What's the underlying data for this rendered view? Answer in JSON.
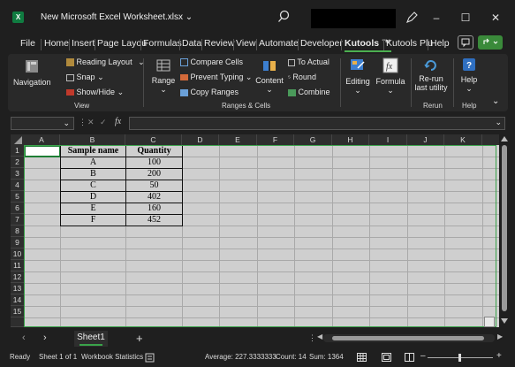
{
  "titlebar": {
    "logo": "X",
    "doc_title": "New Microsoft Excel Worksheet.xlsx ⌄",
    "minimize": "–",
    "maximize": "☐",
    "close": "✕"
  },
  "menu": {
    "tabs": [
      "File",
      "Home",
      "Insert",
      "Page Layou",
      "Formulas",
      "Data",
      "Review",
      "View",
      "Automate",
      "Developer",
      "Kutools ™",
      "Kutools Plu",
      "Help"
    ],
    "active_tab": "Kutools ™"
  },
  "ribbon": {
    "navigation": "Navigation",
    "reading_layout": "Reading Layout",
    "snap": "Snap",
    "show_hide": "Show/Hide",
    "view_group": "View",
    "range": "Range",
    "compare_cells": "Compare Cells",
    "prevent_typing": "Prevent Typing",
    "copy_ranges": "Copy Ranges",
    "content": "Content",
    "to_actual": "To Actual",
    "round": "Round",
    "combine": "Combine",
    "ranges_cells_group": "Ranges & Cells",
    "editing": "Editing",
    "formula": "Formula",
    "rerun_line1": "Re-run",
    "rerun_line2": "last utility",
    "rerun_group": "Rerun",
    "help": "Help",
    "help_group": "Help"
  },
  "formula_bar": {
    "cancel": "✕",
    "enter": "✓",
    "fx": "fx",
    "value": ""
  },
  "columns": [
    "A",
    "B",
    "C",
    "D",
    "E",
    "F",
    "G",
    "H",
    "I",
    "J",
    "K"
  ],
  "rows": [
    "1",
    "2",
    "3",
    "4",
    "5",
    "6",
    "7",
    "8",
    "9",
    "10",
    "11",
    "12",
    "13",
    "14",
    "15"
  ],
  "table": {
    "headers": [
      "Sample name",
      "Quantity"
    ],
    "rows": [
      [
        "A",
        "100"
      ],
      [
        "B",
        "200"
      ],
      [
        "C",
        "50"
      ],
      [
        "D",
        "402"
      ],
      [
        "E",
        "160"
      ],
      [
        "F",
        "452"
      ]
    ]
  },
  "sheets": {
    "active": "Sheet1",
    "add": "+"
  },
  "status": {
    "ready": "Ready",
    "sheet_count": "Sheet 1 of 1",
    "workbook_statistics": "Workbook Statistics",
    "average": "Average: 227.3333333",
    "count": "Count: 14",
    "sum": "Sum: 1364",
    "zoom_minus": "–",
    "zoom_plus": "+"
  }
}
